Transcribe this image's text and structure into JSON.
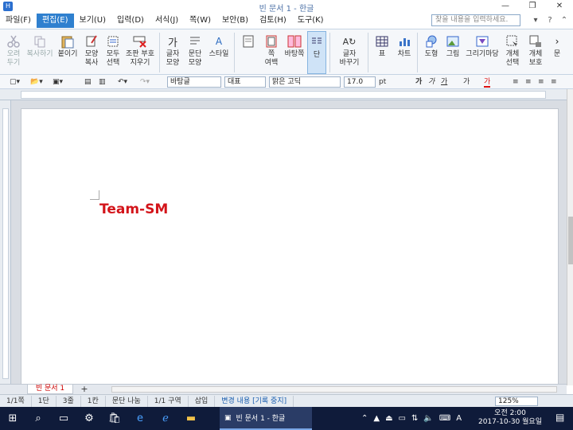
{
  "window": {
    "title": "빈 문서 1 - 한글",
    "minimize": "—",
    "restore": "❐",
    "close": "✕"
  },
  "menu": {
    "items": [
      "파일(F)",
      "편집(E)",
      "보기(U)",
      "입력(D)",
      "서식(J)",
      "쪽(W)",
      "보안(B)",
      "검토(H)",
      "도구(K)"
    ],
    "active_index": 1,
    "search_placeholder": "찾을 내용을 입력하세요."
  },
  "ribbon": {
    "cut": "오려\n두기",
    "copy": "복사하기",
    "paste": "붙이기",
    "format_copy": "모양\n복사",
    "select_all": "모두\n선택",
    "clear_protect": "조판 부호\n지우기",
    "char_shape": "글자\n모양",
    "para_shape": "문단\n모양",
    "style": "스타일",
    "page_margin": "쪽\n여백",
    "background": "바탕쪽",
    "columns": "단",
    "char_change": "글자\n바꾸기",
    "table": "표",
    "chart": "차트",
    "shape": "도형",
    "picture": "그림",
    "gallery": "그리기마당",
    "obj_select": "개체\n선택",
    "obj_protect": "개체\n보호",
    "more": "문"
  },
  "format_toolbar": {
    "style": "바탕글",
    "lang": "대표",
    "font": "맑은 고딕",
    "size": "17.0",
    "unit": "pt",
    "bold": "가",
    "italic": "가",
    "underline": "가",
    "strike": "가",
    "color": "가"
  },
  "document": {
    "text": "Team-SM",
    "text_color": "#d3141a"
  },
  "tabs": {
    "doc_tab": "빈 문서 1",
    "add": "+"
  },
  "status": {
    "page": "1/1쪽",
    "column": "1단",
    "line": "3줄",
    "char": "1칸",
    "split": "문단 나눔",
    "section": "1/1 구역",
    "insert": "삽입",
    "track": "변경 내용 [기록 중지]",
    "zoom": "125%"
  },
  "taskbar": {
    "app_label": "빈 문서 1 - 한글",
    "time": "오전 2:00",
    "date": "2017-10-30 월요일",
    "lang": "A"
  }
}
